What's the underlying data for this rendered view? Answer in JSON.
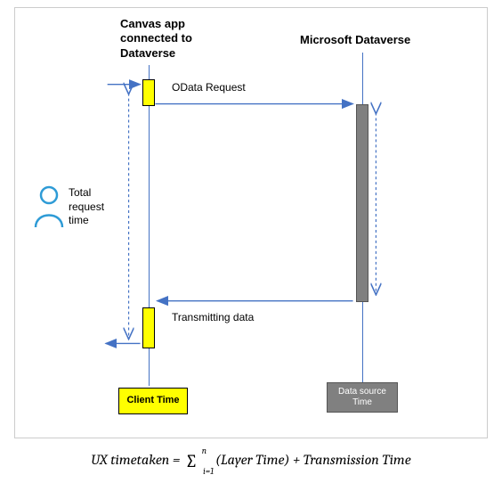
{
  "header": {
    "canvas_app": "Canvas app\nconnected to\nDataverse",
    "dataverse": "Microsoft Dataverse"
  },
  "labels": {
    "odata_request": "OData Request",
    "transmitting_data": "Transmitting data",
    "total_request_time": "Total\nrequest\ntime"
  },
  "boxes": {
    "client_time": "Client Time",
    "data_source_time": "Data source\nTime"
  },
  "formula": {
    "lhs": "UX timetaken",
    "eq": " = ",
    "sigma_sup": "n",
    "sigma_sub": "i=1",
    "term1": "(Layer Time)",
    "plus": " + ",
    "term2": "Transmission Time"
  },
  "icons": {
    "user": "user-icon"
  }
}
